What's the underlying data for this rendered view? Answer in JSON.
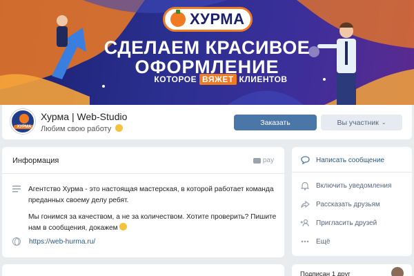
{
  "banner": {
    "brand": "ХУРМА",
    "headline_line1": "СДЕЛАЕМ КРАСИВОЕ",
    "headline_line2": "ОФОРМЛЕНИЕ",
    "headline_line3_pre": "КОТОРОЕ",
    "headline_line3_accent": "ВЯЖЕТ",
    "headline_line3_post": "КЛИЕНТОВ"
  },
  "profile": {
    "avatar_text": "ХУРМА",
    "name": "Хурма | Web-Studio",
    "status": "Любим свою работу",
    "order_button": "Заказать",
    "member_button": "Вы участник"
  },
  "info": {
    "title": "Информация",
    "pay_label": "pay",
    "desc_p1": "Агентство Хурма - это настоящая мастерская, в которой работает команда преданных своему делу ребят.",
    "desc_p2": "Мы гонимся за качеством, а не за количеством. Хотите проверить? Пишите нам в сообщения, докажем",
    "website": "https://web-hurma.ru/"
  },
  "actions": {
    "write_message": "Написать сообщение",
    "enable_notifications": "Включить уведомления",
    "tell_friends": "Рассказать друзьям",
    "invite_friends": "Пригласить друзей",
    "more": "Ещё"
  },
  "friends": {
    "subscribed": "Подписан 1 друг"
  },
  "colors": {
    "accent_blue": "#4a76a8",
    "brand_orange": "#f07a22",
    "banner_navy": "#1a1f6e",
    "link": "#2a5885"
  }
}
